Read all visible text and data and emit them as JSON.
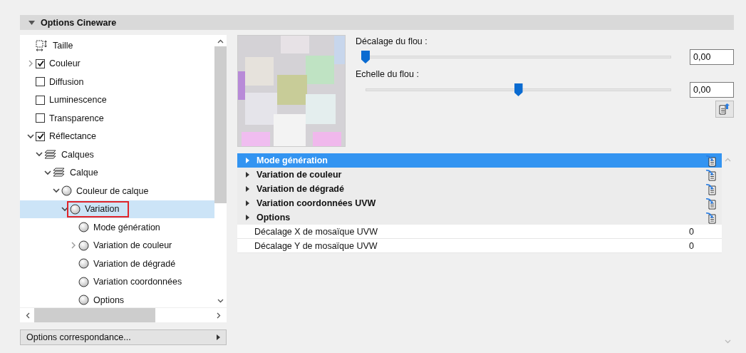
{
  "panel": {
    "title": "Options Cineware",
    "expanded": true
  },
  "tree": [
    {
      "label": "Taille",
      "kind": "size"
    },
    {
      "label": "Couleur",
      "kind": "checkbox",
      "checked": true,
      "expanded": false
    },
    {
      "label": "Diffusion",
      "kind": "checkbox",
      "checked": false
    },
    {
      "label": "Luminescence",
      "kind": "checkbox",
      "checked": false
    },
    {
      "label": "Transparence",
      "kind": "checkbox",
      "checked": false
    },
    {
      "label": "Réflectance",
      "kind": "checkbox",
      "checked": true,
      "expanded": true,
      "children": [
        {
          "label": "Calques",
          "kind": "layers",
          "expanded": true,
          "children": [
            {
              "label": "Calque",
              "kind": "layers",
              "expanded": true,
              "children": [
                {
                  "label": "Couleur de calque",
                  "kind": "shader",
                  "expanded": true,
                  "children": [
                    {
                      "label": "Variation",
                      "kind": "shader",
                      "expanded": true,
                      "selected": true,
                      "highlighted": true,
                      "children": [
                        {
                          "label": "Mode génération",
                          "kind": "shader"
                        },
                        {
                          "label": "Variation de couleur",
                          "kind": "shader",
                          "expanded": false
                        },
                        {
                          "label": "Variation de dégradé",
                          "kind": "shader"
                        },
                        {
                          "label": "Variation coordonnées",
                          "kind": "shader"
                        },
                        {
                          "label": "Options",
                          "kind": "shader"
                        }
                      ]
                    }
                  ]
                }
              ]
            }
          ]
        }
      ]
    }
  ],
  "match_button": {
    "label": "Options correspondance..."
  },
  "sliders": [
    {
      "label": "Décalage du flou :",
      "level": 0.0,
      "value": "0,00"
    },
    {
      "label": "Echelle du flou :",
      "level": 0.5,
      "value": "0,00"
    }
  ],
  "properties": [
    {
      "kind": "group",
      "label": "Mode génération",
      "selected": true
    },
    {
      "kind": "group",
      "label": "Variation de couleur",
      "selected": false
    },
    {
      "kind": "group",
      "label": "Variation de dégradé",
      "selected": false
    },
    {
      "kind": "group",
      "label": "Variation coordonnées UVW",
      "selected": false
    },
    {
      "kind": "group",
      "label": "Options",
      "selected": false
    },
    {
      "kind": "value",
      "label": "Décalage X de mosaïque UVW",
      "value": "0",
      "selected": false
    },
    {
      "kind": "value",
      "label": "Décalage Y de mosaïque UVW",
      "value": "0",
      "selected": false
    }
  ]
}
